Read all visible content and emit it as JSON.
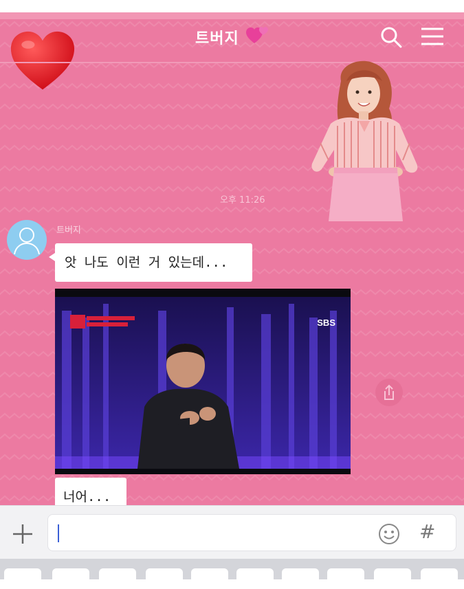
{
  "header": {
    "title": "트버지",
    "colors": {
      "chat_background": "#ec7aa1",
      "accent": "#ffffff"
    }
  },
  "messages": {
    "timestamp": "오후 11:26",
    "sender_name": "트버지",
    "text_1": "앗 나도 이런 거 있는데...",
    "text_2": "너어...",
    "video": {
      "channel_logo": "SBS",
      "program_badge": "KPOP STAR"
    }
  },
  "input_bar": {
    "value": "",
    "icons": [
      "plus-icon",
      "emoji-icon",
      "hashtag-icon"
    ],
    "hash_label": "#"
  }
}
